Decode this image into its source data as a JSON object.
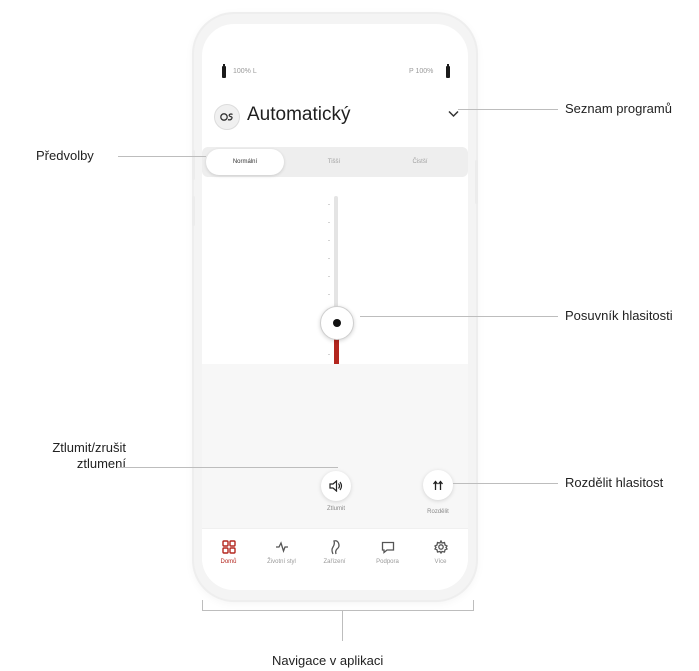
{
  "callouts": {
    "presets": "Předvolby",
    "program_list": "Seznam programů",
    "volume_slider": "Posuvník hlasitosti",
    "mute": "Ztlumit/zrušit ztlumení",
    "split_volume": "Rozdělit hlasitost",
    "navigation": "Navigace v aplikaci"
  },
  "status": {
    "left_battery": "100% L",
    "right_battery": "P 100%"
  },
  "program": {
    "icon": "program-icon",
    "title": "Automatický"
  },
  "presets": {
    "items": [
      "Normální",
      "Tišší",
      "Čistší"
    ],
    "selected": "Normální"
  },
  "volume": {
    "level": 0.5
  },
  "controls": {
    "mute_label": "Ztlumit",
    "split_label": "Rozdělit"
  },
  "tabs": [
    {
      "label": "Domů",
      "icon": "grid-icon",
      "active": true
    },
    {
      "label": "Životní styl",
      "icon": "activity-icon",
      "active": false
    },
    {
      "label": "Zařízení",
      "icon": "hearing-aid-icon",
      "active": false
    },
    {
      "label": "Podpora",
      "icon": "chat-icon",
      "active": false
    },
    {
      "label": "Více",
      "icon": "gear-icon",
      "active": false
    }
  ],
  "colors": {
    "accent": "#b3261e",
    "track": "#e4e4e4"
  }
}
